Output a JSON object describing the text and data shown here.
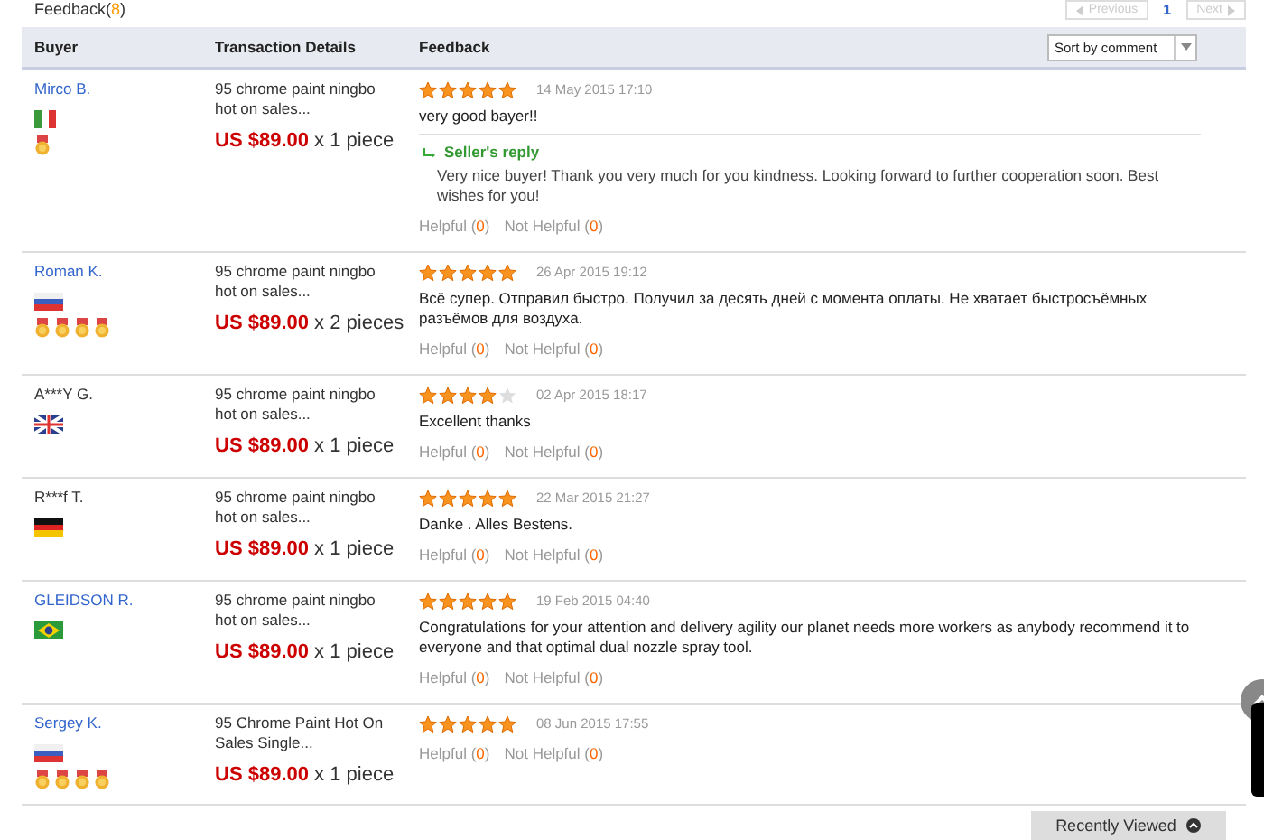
{
  "header": {
    "title": "Feedback(",
    "count": "8",
    "title_end": ")"
  },
  "pagination": {
    "previous": {
      "label": "Previous",
      "disabled": true
    },
    "pages": [
      {
        "label": "1",
        "selected": true
      }
    ],
    "next": {
      "label": "Next",
      "disabled": true
    }
  },
  "table": {
    "columns": [
      "Buyer",
      "Transaction Details",
      "Feedback"
    ],
    "sort": {
      "value": "Sort by comment"
    },
    "rows": [
      {
        "buyer": "Mirco B.",
        "buyer_link": true,
        "badges": [
          {
            "kind": "flag-italy"
          },
          {
            "kind": "medals",
            "medals": [
              {
                "kind": "medal"
              }
            ]
          }
        ],
        "product": "95 chrome paint ningbo hot on sales...",
        "price": "US $89.00",
        "quantity": "x 1 piece",
        "stars": 5,
        "date": "14 May 2015 17:10",
        "comment": "very good bayer!!",
        "reply": {
          "title": "Seller's reply",
          "text": "Very nice buyer! Thank you very much for you kindness. Looking forward to further cooperation soon. Best wishes for you!"
        },
        "helpful": "Helpful (",
        "helpful_count": "0",
        "helpful_end": ")",
        "not_helpful": "Not Helpful (",
        "not_helpful_count": "0",
        "not_helpful_end": ")"
      },
      {
        "buyer": "Roman K.",
        "buyer_link": true,
        "badges": [
          {
            "kind": "flag-russia"
          },
          {
            "kind": "medals",
            "medals": [
              {
                "kind": "medal"
              },
              {
                "kind": "medal"
              },
              {
                "kind": "medal"
              },
              {
                "kind": "medal"
              }
            ]
          }
        ],
        "product": "95 chrome paint ningbo hot on sales...",
        "price": "US $89.00",
        "quantity": "x 2 pieces",
        "stars": 5,
        "date": "26 Apr 2015 19:12",
        "comment": "Всё супер. Отправил быстро. Получил за десять дней с момента оплаты. Не хватает быстросъёмных разъёмов для воздуха.",
        "helpful": "Helpful (",
        "helpful_count": "0",
        "helpful_end": ")",
        "not_helpful": "Not Helpful (",
        "not_helpful_count": "0",
        "not_helpful_end": ")"
      },
      {
        "buyer": "A***Y G.",
        "buyer_link": false,
        "badges": [
          {
            "kind": "flag-uk"
          }
        ],
        "product": "95 chrome paint ningbo hot on sales...",
        "price": "US $89.00",
        "quantity": "x 1 piece",
        "stars": 4,
        "date": "02 Apr 2015 18:17",
        "comment": "Excellent thanks",
        "helpful": "Helpful (",
        "helpful_count": "0",
        "helpful_end": ")",
        "not_helpful": "Not Helpful (",
        "not_helpful_count": "0",
        "not_helpful_end": ")"
      },
      {
        "buyer": "R***f T.",
        "buyer_link": false,
        "badges": [
          {
            "kind": "flag-germany"
          }
        ],
        "product": "95 chrome paint ningbo hot on sales...",
        "price": "US $89.00",
        "quantity": "x 1 piece",
        "stars": 5,
        "date": "22 Mar 2015 21:27",
        "comment": "Danke . Alles Bestens.",
        "helpful": "Helpful (",
        "helpful_count": "0",
        "helpful_end": ")",
        "not_helpful": "Not Helpful (",
        "not_helpful_count": "0",
        "not_helpful_end": ")"
      },
      {
        "buyer": "GLEIDSON R.",
        "buyer_link": true,
        "badges": [
          {
            "kind": "flag-brazil"
          }
        ],
        "product": "95 chrome paint ningbo hot on sales...",
        "price": "US $89.00",
        "quantity": "x 1 piece",
        "stars": 5,
        "date": "19 Feb 2015 04:40",
        "comment": "Congratulations for your attention and delivery agility our planet needs more workers as anybody recommend it to everyone and that optimal dual nozzle spray tool.",
        "helpful": "Helpful (",
        "helpful_count": "0",
        "helpful_end": ")",
        "not_helpful": "Not Helpful (",
        "not_helpful_count": "0",
        "not_helpful_end": ")"
      },
      {
        "buyer": "Sergey K.",
        "buyer_link": true,
        "badges": [
          {
            "kind": "flag-russia"
          },
          {
            "kind": "medals",
            "medals": [
              {
                "kind": "medal"
              },
              {
                "kind": "medal"
              },
              {
                "kind": "medal"
              },
              {
                "kind": "medal"
              }
            ]
          }
        ],
        "product": "95 Chrome Paint Hot On Sales Single...",
        "price": "US $89.00",
        "quantity": "x 1 piece",
        "stars": 5,
        "date": "08 Jun 2015 17:55",
        "helpful": "Helpful (",
        "helpful_count": "0",
        "helpful_end": ")",
        "not_helpful": "Not Helpful (",
        "not_helpful_count": "0",
        "not_helpful_end": ")"
      }
    ]
  },
  "recently_viewed": {
    "label": "Recently Viewed"
  }
}
